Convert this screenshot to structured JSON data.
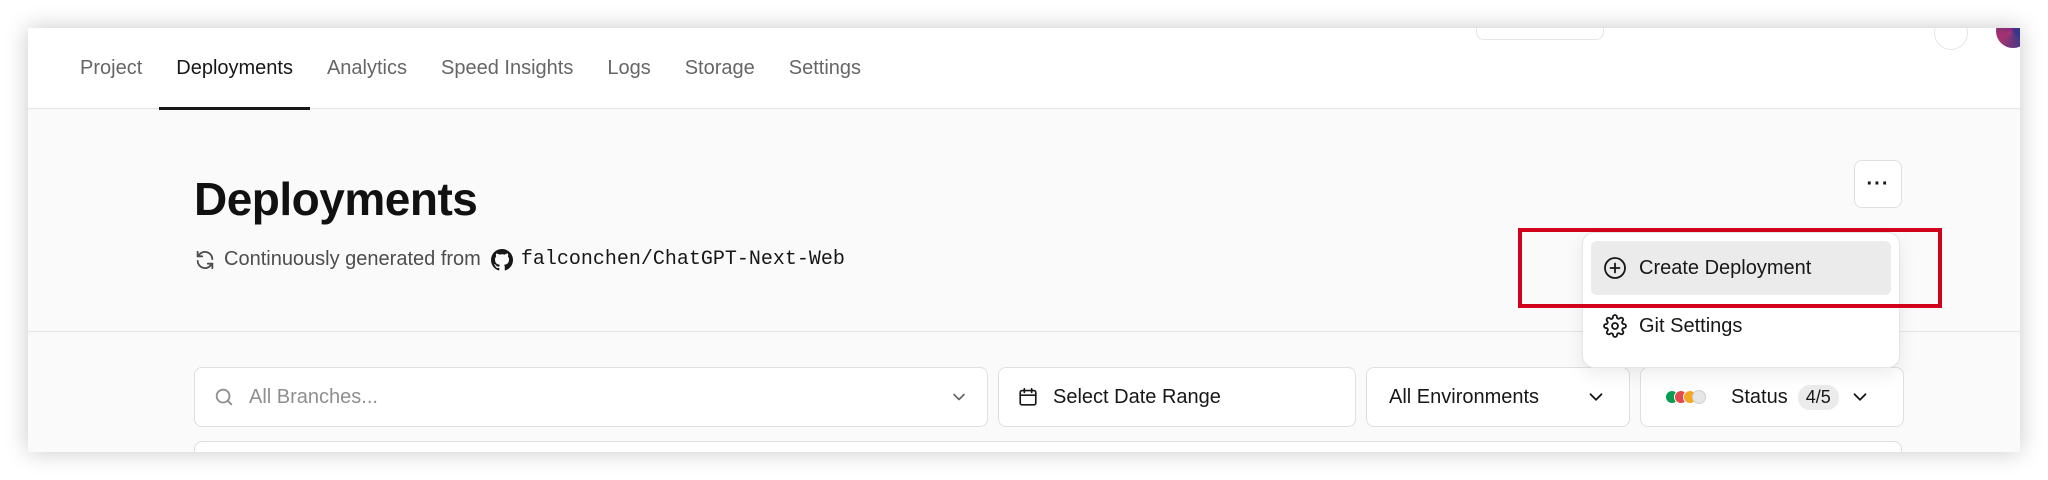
{
  "nav": {
    "tabs": [
      {
        "label": "Project"
      },
      {
        "label": "Deployments"
      },
      {
        "label": "Analytics"
      },
      {
        "label": "Speed Insights"
      },
      {
        "label": "Logs"
      },
      {
        "label": "Storage"
      },
      {
        "label": "Settings"
      }
    ],
    "active_tab": "Deployments"
  },
  "header": {
    "title": "Deployments",
    "source_prefix": "Continuously generated from",
    "repo": "falconchen/ChatGPT-Next-Web",
    "more_label": "···"
  },
  "menu": {
    "items": [
      {
        "label": "Create Deployment",
        "icon": "plus-circle-icon"
      },
      {
        "label": "Git Settings",
        "icon": "gear-icon"
      }
    ]
  },
  "filters": {
    "branch_placeholder": "All Branches...",
    "date_label": "Select Date Range",
    "environment_label": "All Environments",
    "status_label": "Status",
    "status_count": "4/5"
  },
  "colors": {
    "highlight": "#d0021b",
    "status_dots": [
      "#0a9d4f",
      "#e5484d",
      "#f5a623",
      "#cfcfcf"
    ]
  }
}
